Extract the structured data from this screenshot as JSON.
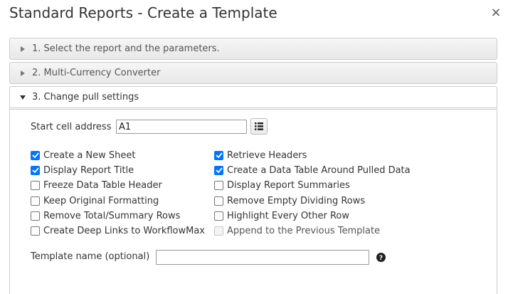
{
  "dialog": {
    "title": "Standard Reports - Create a Template",
    "close_glyph": "×"
  },
  "sections": [
    {
      "label": "1. Select the report and the parameters.",
      "expanded": false
    },
    {
      "label": "2. Multi-Currency Converter",
      "expanded": false
    },
    {
      "label": "3. Change pull settings",
      "expanded": true
    }
  ],
  "pull_settings": {
    "start_cell_label": "Start cell address",
    "start_cell_value": "A1",
    "list_button_icon": "list-icon",
    "template_name_label": "Template name (optional)",
    "template_name_value": "",
    "help_icon": "question-circle-icon",
    "options_left": [
      {
        "label": "Create a New Sheet",
        "checked": true,
        "disabled": false
      },
      {
        "label": "Display Report Title",
        "checked": true,
        "disabled": false
      },
      {
        "label": "Freeze Data Table Header",
        "checked": false,
        "disabled": false
      },
      {
        "label": "Keep Original Formatting",
        "checked": false,
        "disabled": false
      },
      {
        "label": "Remove Total/Summary Rows",
        "checked": false,
        "disabled": false
      },
      {
        "label": "Create Deep Links to WorkflowMax",
        "checked": false,
        "disabled": false
      }
    ],
    "options_right": [
      {
        "label": "Retrieve Headers",
        "checked": true,
        "disabled": false
      },
      {
        "label": "Create a Data Table Around Pulled Data",
        "checked": true,
        "disabled": false
      },
      {
        "label": "Display Report Summaries",
        "checked": false,
        "disabled": false
      },
      {
        "label": "Remove Empty Dividing Rows",
        "checked": false,
        "disabled": false
      },
      {
        "label": "Highlight Every Other Row",
        "checked": false,
        "disabled": false
      },
      {
        "label": "Append to the Previous Template",
        "checked": false,
        "disabled": true
      }
    ]
  },
  "colors": {
    "checkbox_checked": "#0075ff",
    "header_border": "#cccccc"
  }
}
